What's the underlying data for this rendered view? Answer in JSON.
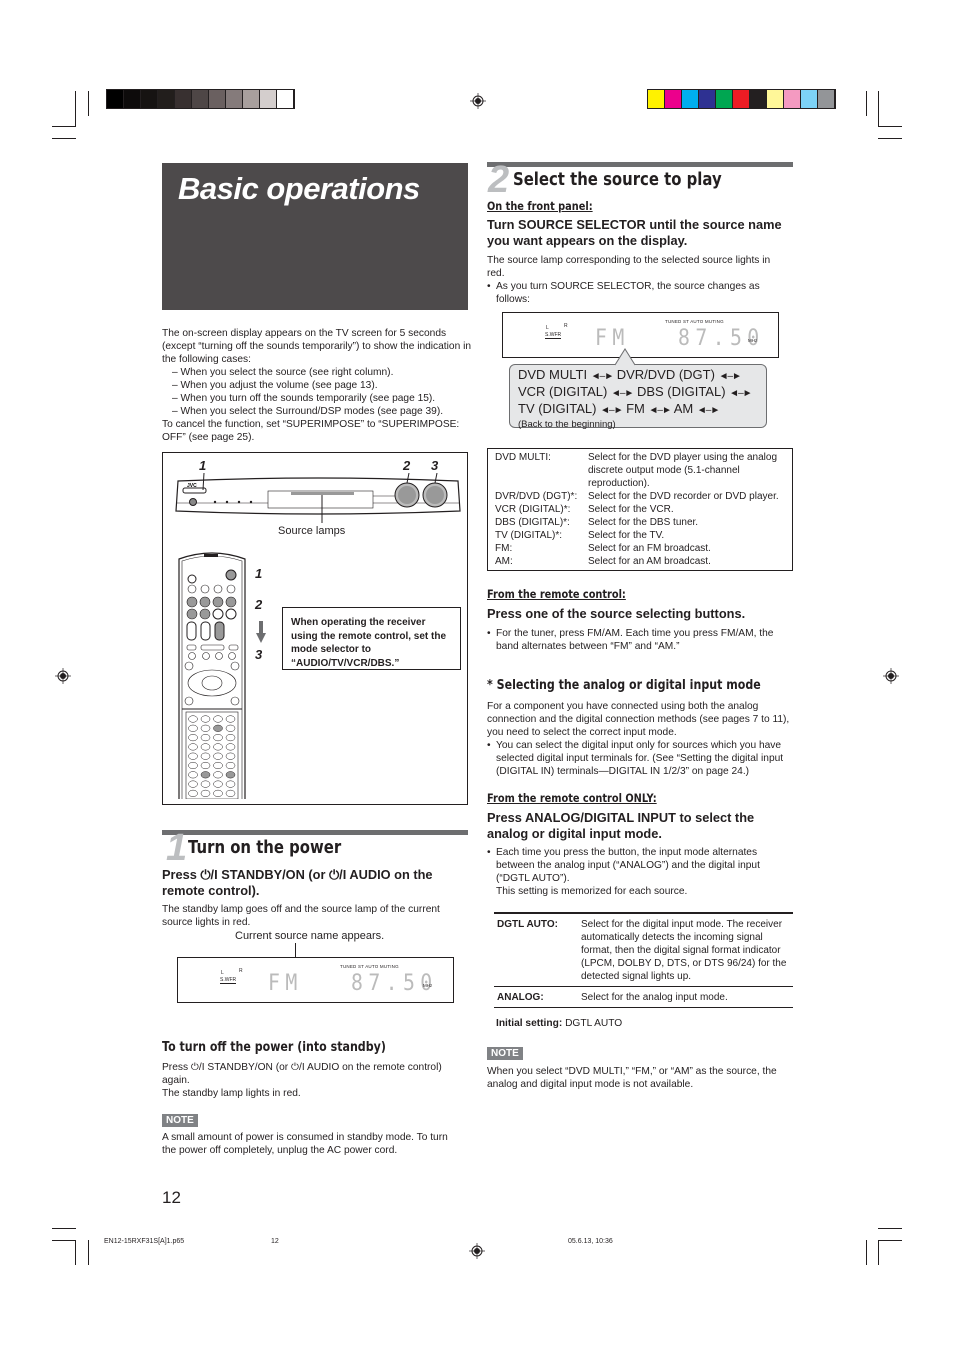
{
  "printer_marks": {
    "gray_swatches": [
      "#000000",
      "#0d0b0b",
      "#161312",
      "#221e1c",
      "#383030",
      "#4e4646",
      "#6a6060",
      "#857b7b",
      "#a89f9d",
      "#d4cecd",
      "#ffffff"
    ],
    "color_swatches": [
      "#fff200",
      "#ec008c",
      "#00aeef",
      "#2e3192",
      "#00a651",
      "#ed1c24",
      "#231f20",
      "#fff799",
      "#f49ac1",
      "#7dd3f7",
      "#939598"
    ]
  },
  "title": "Basic operations",
  "intro": {
    "lead": "The on-screen display appears on the TV screen for 5 seconds (except “turning off the sounds temporarily”) to show the indication in the following cases:",
    "cases": [
      "When you select the source (see right column).",
      "When you adjust the volume (see page 13).",
      "When you turn off the sounds temporarily (see page 15).",
      "When you select the Surround/DSP modes (see page 39)."
    ],
    "cancel": "To cancel the function, set “SUPERIMPOSE” to “SUPERIMPOSE: OFF” (see page 25)."
  },
  "figure": {
    "front_panel_brand": "JVC",
    "callouts": [
      "1",
      "2",
      "3"
    ],
    "source_lamps_label": "Source lamps",
    "remote_callouts": [
      "1",
      "2",
      "3"
    ],
    "mode_note": "When operating the receiver using the remote control, set the mode selector to “AUDIO/TV/VCR/DBS.”"
  },
  "section1": {
    "number": "1",
    "heading": "Turn on the power",
    "instruction": "Press ⏻/I STANDBY/ON (or ⏻/I AUDIO on the remote control).",
    "body": "The standby lamp goes off and the source lamp of the current source lights in red.",
    "display_caption": "Current source name appears.",
    "display": {
      "l": "L",
      "r": "R",
      "swfr": "S.WFR",
      "indicators": "TUNED  ST  AUTO MUTING",
      "source": "FM",
      "freq": "87.50",
      "unit": "MHz"
    },
    "standby_heading": "To turn off the power (into standby)",
    "standby_body": [
      "Press ⏻/I STANDBY/ON (or ⏻/I AUDIO on the remote control) again.",
      "The standby lamp lights in red."
    ],
    "note_tag": "NOTE",
    "note": "A small amount of power is consumed in standby mode. To turn the power off completely, unplug the AC power cord."
  },
  "section2": {
    "number": "2",
    "heading": "Select the source to play",
    "front_panel_label": "On the front panel:",
    "front_instruction": "Turn SOURCE SELECTOR until the source name you want appears on the display.",
    "front_body": "The source lamp corresponding to the selected source lights in red.",
    "front_bullet": "As you turn SOURCE SELECTOR, the source changes as follows:",
    "display": {
      "l": "L",
      "r": "R",
      "swfr": "S.WFR",
      "indicators": "TUNED  ST  AUTO MUTING",
      "source": "FM",
      "freq": "87.50",
      "unit": "MHz"
    },
    "cycle": {
      "line1": [
        "DVD MULTI",
        "DVR/DVD (DGT)"
      ],
      "line2": [
        "VCR (DIGITAL)",
        "DBS (DIGITAL)"
      ],
      "line3": [
        "TV (DIGITAL)",
        "FM",
        "AM"
      ],
      "arrow": "◄–►",
      "back": "(Back to the beginning)"
    },
    "sources": [
      {
        "name": "DVD MULTI:",
        "desc": "Select for the DVD player using the analog discrete output mode (5.1-channel reproduction)."
      },
      {
        "name": "DVR/DVD (DGT)*:",
        "desc": "Select for the DVD recorder or DVD player."
      },
      {
        "name": "VCR (DIGITAL)*:",
        "desc": "Select for the VCR."
      },
      {
        "name": "DBS (DIGITAL)*:",
        "desc": "Select for the DBS tuner."
      },
      {
        "name": "TV (DIGITAL)*:",
        "desc": "Select for the TV."
      },
      {
        "name": "FM:",
        "desc": "Select for an FM broadcast."
      },
      {
        "name": "AM:",
        "desc": "Select for an AM broadcast."
      }
    ],
    "remote_label": "From the remote control:",
    "remote_instruction": "Press one of the source selecting buttons.",
    "remote_bullet": "For the tuner, press FM/AM. Each time you press FM/AM, the band alternates between “FM” and “AM.”",
    "analog_heading": "* Selecting the analog or digital input mode",
    "analog_body": "For a component you have connected using both the analog connection and the digital connection methods (see pages 7 to 11), you need to select the correct input mode.",
    "analog_bullet": "You can select the digital input only for sources which you have selected digital input terminals for. (See “Setting the digital input (DIGITAL IN) terminals—DIGITAL IN 1/2/3” on page 24.)",
    "remote_only_label": "From the remote control ONLY:",
    "remote_only_instruction": "Press ANALOG/DIGITAL INPUT to select the analog or digital input mode.",
    "remote_only_bullet": "Each time you press the button, the input mode alternates between the analog input (“ANALOG”) and the digital input (“DGTL AUTO”).",
    "remote_only_memo": "This setting is memorized for each source.",
    "modes": [
      {
        "name": "DGTL AUTO:",
        "desc": "Select for the digital input mode. The receiver automatically detects the incoming signal format, then the digital signal format indicator (LPCM, DOLBY D, DTS, or DTS 96/24) for the detected signal lights up."
      },
      {
        "name": "ANALOG:",
        "desc": "Select for the analog input mode."
      }
    ],
    "initial_label": "Initial setting:",
    "initial_value": "DGTL AUTO",
    "note_tag": "NOTE",
    "note": "When you select “DVD MULTI,” “FM,” or “AM” as the source, the analog and digital input mode is not available."
  },
  "page_number": "12",
  "footer": {
    "file": "EN12-15RXF31S[A]1.p65",
    "page": "12",
    "timestamp": "05.6.13, 10:36"
  }
}
